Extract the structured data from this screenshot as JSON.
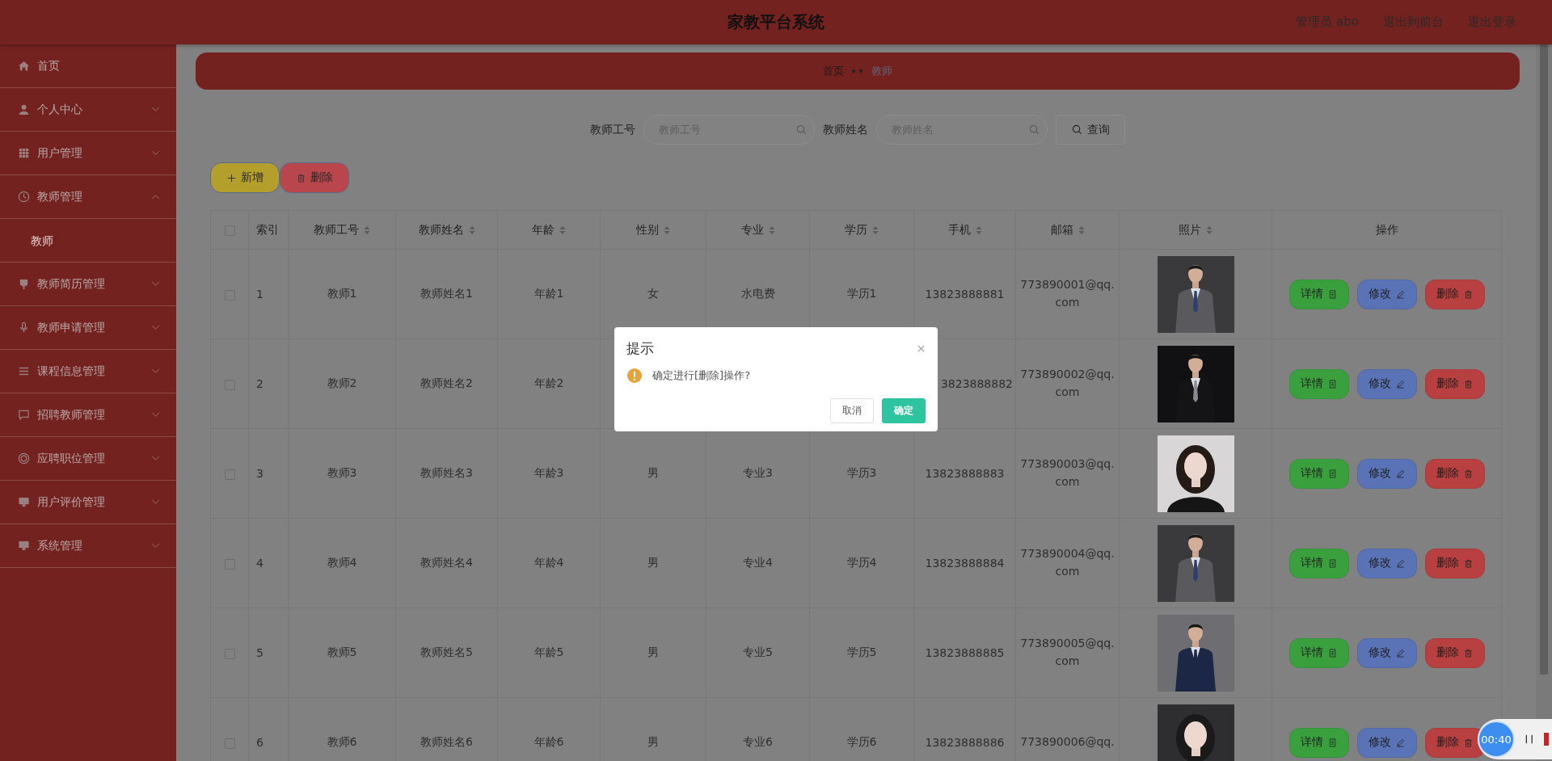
{
  "header": {
    "title": "家教平台系统",
    "links": [
      "管理员 abo",
      "退出到前台",
      "退出登录"
    ]
  },
  "sidebar": {
    "items": [
      {
        "label": "首页"
      },
      {
        "label": "个人中心",
        "expanded": false
      },
      {
        "label": "用户管理",
        "expanded": false
      },
      {
        "label": "教师管理",
        "expanded": true,
        "children": [
          {
            "label": "教师",
            "selected": true
          }
        ]
      },
      {
        "label": "教师简历管理",
        "expanded": false
      },
      {
        "label": "教师申请管理",
        "expanded": false
      },
      {
        "label": "课程信息管理",
        "expanded": false
      },
      {
        "label": "招聘教师管理",
        "expanded": false
      },
      {
        "label": "应聘职位管理",
        "expanded": false
      },
      {
        "label": "用户评价管理",
        "expanded": false
      },
      {
        "label": "系统管理",
        "expanded": false
      }
    ]
  },
  "breadcrumb": {
    "separator": "★★",
    "items": [
      {
        "label": "首页",
        "selected": false
      },
      {
        "label": "教师",
        "selected": true
      }
    ]
  },
  "search": {
    "fields": [
      {
        "label": "教师工号",
        "placeholder": "教师工号"
      },
      {
        "label": "教师姓名",
        "placeholder": "教师姓名"
      }
    ],
    "button": "查询"
  },
  "actions": [
    {
      "label": "新增",
      "kind": "add"
    },
    {
      "label": "删除",
      "kind": "delete"
    }
  ],
  "table": {
    "select_all_checked": false,
    "columns": [
      {
        "label": "索引",
        "sortable": false
      },
      {
        "label": "教师工号",
        "sortable": true
      },
      {
        "label": "教师姓名",
        "sortable": true
      },
      {
        "label": "年龄",
        "sortable": true
      },
      {
        "label": "性别",
        "sortable": true
      },
      {
        "label": "专业",
        "sortable": true
      },
      {
        "label": "学历",
        "sortable": true
      },
      {
        "label": "手机",
        "sortable": true
      },
      {
        "label": "邮箱",
        "sortable": true
      },
      {
        "label": "照片",
        "sortable": true
      },
      {
        "label": "操作",
        "sortable": false
      }
    ],
    "rows": [
      {
        "checked": false,
        "cells": [
          "1",
          "教师1",
          "教师姓名1",
          "年龄1",
          "女",
          "水电费",
          "学历1",
          "13823888881",
          "773890001@qq.com"
        ],
        "buttons": [
          {
            "label": "详情",
            "kind": "detail"
          },
          {
            "label": "修改",
            "kind": "edit"
          },
          {
            "label": "删除",
            "kind": "delete"
          }
        ]
      },
      {
        "checked": false,
        "cells": [
          "2",
          "教师2",
          "教师姓名2",
          "年龄2",
          null,
          null,
          null,
          "3823888882",
          "773890002@qq.com"
        ],
        "phone_clipped": true,
        "buttons": [
          {
            "label": "详情",
            "kind": "detail"
          },
          {
            "label": "修改",
            "kind": "edit"
          },
          {
            "label": "删除",
            "kind": "delete"
          }
        ]
      },
      {
        "checked": false,
        "cells": [
          "3",
          "教师3",
          "教师姓名3",
          "年龄3",
          "男",
          "专业3",
          "学历3",
          "13823888883",
          "773890003@qq.com"
        ],
        "buttons": [
          {
            "label": "详情",
            "kind": "detail"
          },
          {
            "label": "修改",
            "kind": "edit"
          },
          {
            "label": "删除",
            "kind": "delete"
          }
        ]
      },
      {
        "checked": false,
        "cells": [
          "4",
          "教师4",
          "教师姓名4",
          "年龄4",
          "男",
          "专业4",
          "学历4",
          "13823888884",
          "773890004@qq.com"
        ],
        "buttons": [
          {
            "label": "详情",
            "kind": "detail"
          },
          {
            "label": "修改",
            "kind": "edit"
          },
          {
            "label": "删除",
            "kind": "delete"
          }
        ]
      },
      {
        "checked": false,
        "cells": [
          "5",
          "教师5",
          "教师姓名5",
          "年龄5",
          "男",
          "专业5",
          "学历5",
          "13823888885",
          "773890005@qq.com"
        ],
        "buttons": [
          {
            "label": "详情",
            "kind": "detail"
          },
          {
            "label": "修改",
            "kind": "edit"
          },
          {
            "label": "删除",
            "kind": "delete"
          }
        ]
      },
      {
        "checked": false,
        "cells": [
          "6",
          "教师6",
          "教师姓名6",
          "年龄6",
          "男",
          "专业6",
          "学历6",
          "13823888886",
          "773890006@qq."
        ],
        "buttons": [
          {
            "label": "详情",
            "kind": "detail"
          },
          {
            "label": "修改",
            "kind": "edit"
          },
          {
            "label": "删除",
            "kind": "delete"
          }
        ]
      }
    ]
  },
  "dialog": {
    "title": "提示",
    "message": "确定进行[删除]操作?",
    "buttons": [
      {
        "label": "取消",
        "kind": "cancel"
      },
      {
        "label": "确定",
        "kind": "confirm"
      }
    ]
  },
  "recorder": {
    "time": "00:40"
  }
}
